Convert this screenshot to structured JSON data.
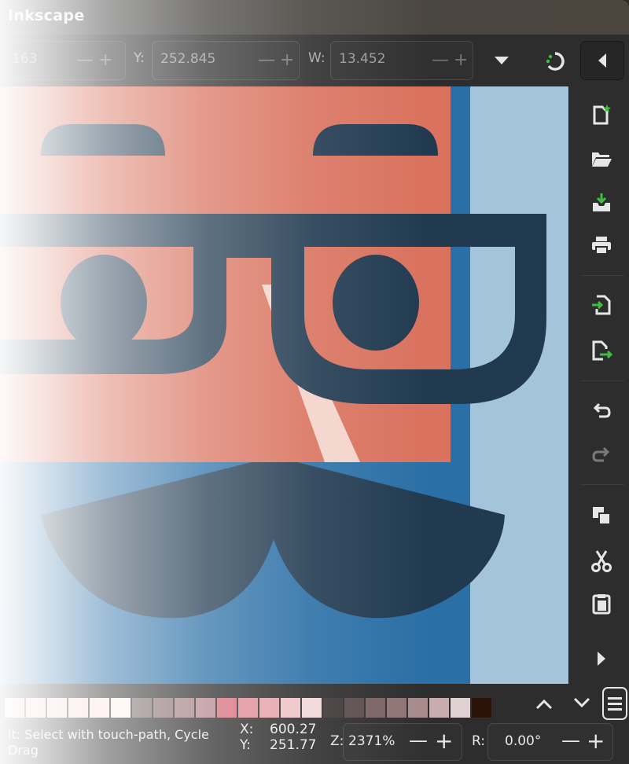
{
  "app": {
    "title": "Inkscape"
  },
  "toolbar": {
    "x_value": "163",
    "y_label": "Y:",
    "y_value": "252.845",
    "w_label": "W:",
    "w_value": "13.452",
    "dropdown_icon": "triangle-down-icon",
    "snap_icon": "snap-icon",
    "collapse_icon": "triangle-left-icon"
  },
  "right_toolbar": {
    "items": [
      "new-document-icon",
      "open-folder-icon",
      "save-icon",
      "print-icon",
      "import-icon",
      "export-icon",
      "undo-icon",
      "redo-icon",
      "duplicate-icon",
      "cut-icon",
      "paste-icon",
      "more-icon"
    ]
  },
  "palette": {
    "colors": [
      "#f6c9cb",
      "#f8d0d1",
      "#f9d8d8",
      "#fadcdc",
      "#fce4e4",
      "#fdf0ef",
      "#7a6a6a",
      "#8a6f71",
      "#a27f83",
      "#b88891",
      "#d6707e",
      "#e08c94",
      "#e4a2a7",
      "#eec2c5",
      "#f1d6d7",
      "#3e3637",
      "#5a4b4c",
      "#7a6162",
      "#8f7374",
      "#a78b8c",
      "#c7adae",
      "#e2d1d2",
      "#2a1208"
    ],
    "scroll_up_icon": "chevron-up-icon",
    "scroll_down_icon": "chevron-down-icon",
    "menu_icon": "hamburger-icon"
  },
  "status": {
    "message_line1": "lt: Select with touch-path, Cycle",
    "message_line2": "Drag",
    "x_label": "X:",
    "x_value": "600.27",
    "y_label": "Y:",
    "y_value": "251.77",
    "zoom_label": "Z:",
    "zoom_value": "2371%",
    "rotation_label": "R:",
    "rotation_value": "0.00°"
  },
  "colors": {
    "skin": "#d9725e",
    "hair_blue": "#2a6fa6",
    "light_blue": "#a4c4db",
    "glasses": "#213a50",
    "highlight": "#f3d3ca"
  }
}
